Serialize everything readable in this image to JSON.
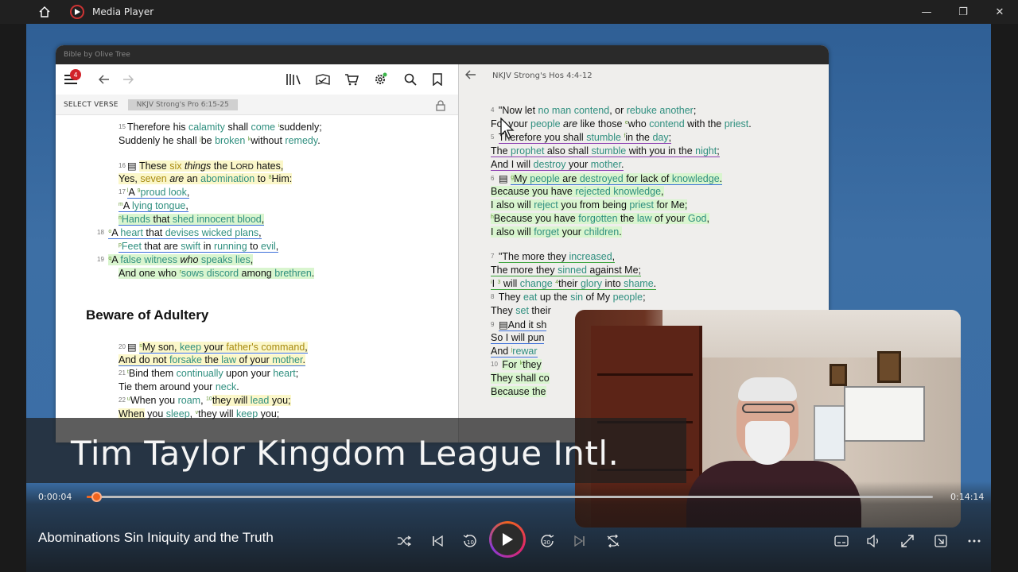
{
  "window": {
    "title": "Media Player",
    "minimize": "—",
    "restore": "❐",
    "close": "✕"
  },
  "olive_tree": {
    "title": "Bible by Olive Tree",
    "notification_count": "4",
    "select_verse": "SELECT VERSE",
    "left_ref": "NKJV Strong's Pro 6:15-25",
    "right_ref": "Hos 4:4-12",
    "right_ref_full": "NKJV Strong's Hos 4:4-12",
    "heading": "Beware of Adultery"
  },
  "banner": {
    "text": "Tim Taylor Kingdom League Intl."
  },
  "player": {
    "elapsed": "0:00:04",
    "duration": "0:14:14",
    "progress_fraction": 0.011,
    "now_playing": "Abominations Sin Iniquity and the Truth",
    "skip_back": "10",
    "skip_forward": "30"
  },
  "colors": {
    "accent": "#f0641e",
    "badge": "#d2232a",
    "highlight_yellow": "#fbf7c9",
    "highlight_green": "#d9f5cf"
  },
  "icons": [
    "home-icon",
    "media-player-logo-icon",
    "menu-icon",
    "back-arrow-icon",
    "forward-arrow-icon",
    "library-icon",
    "reading-plan-icon",
    "store-cart-icon",
    "settings-gear-icon",
    "search-icon",
    "bookmark-icon",
    "lock-icon",
    "shuffle-icon",
    "previous-icon",
    "skip-back-icon",
    "play-icon",
    "skip-forward-icon",
    "next-icon",
    "repeat-icon",
    "captions-icon",
    "volume-icon",
    "fullscreen-icon",
    "mini-player-icon",
    "more-icon"
  ]
}
